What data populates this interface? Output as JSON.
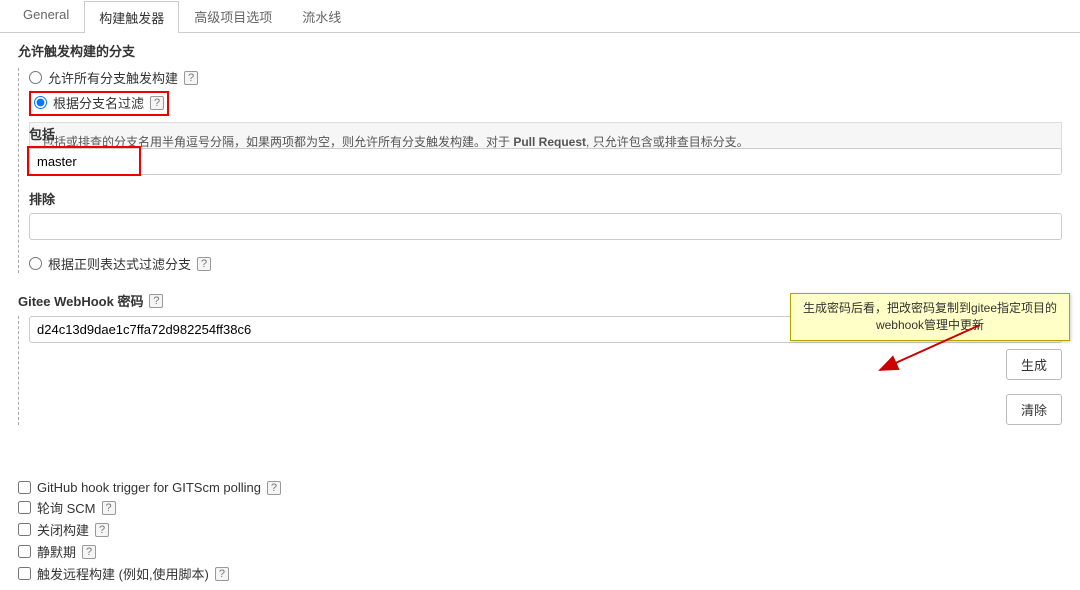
{
  "tabs": {
    "general": "General",
    "triggers": "构建触发器",
    "advanced": "高级项目选项",
    "pipeline": "流水线"
  },
  "branchSection": {
    "title": "允许触发构建的分支",
    "radioAll": "允许所有分支触发构建",
    "radioFilter": "根据分支名过滤",
    "description_prefix": "包括或排查的分支名用半角逗号分隔，如果两项都为空，则允许所有分支触发构建。对于 ",
    "description_bold": "Pull Request",
    "description_suffix": ", 只允许包含或排查目标分支。",
    "includeLabel": "包括",
    "includeValue": "master",
    "excludeLabel": "排除",
    "excludeValue": "",
    "radioRegex": "根据正则表达式过滤分支"
  },
  "webhook": {
    "label": "Gitee WebHook 密码",
    "value": "d24c13d9dae1c7ffa72d982254ff38c6",
    "generateBtn": "生成",
    "clearBtn": "清除"
  },
  "annotation": "生成密码后看，把改密码复制到gitee指定项目的webhook管理中更新",
  "checkboxes": {
    "github": "GitHub hook trigger for GITScm polling",
    "pollScm": "轮询 SCM",
    "closeBuild": "关闭构建",
    "quiet": "静默期",
    "remote": "触发远程构建 (例如,使用脚本)"
  },
  "help": "?"
}
